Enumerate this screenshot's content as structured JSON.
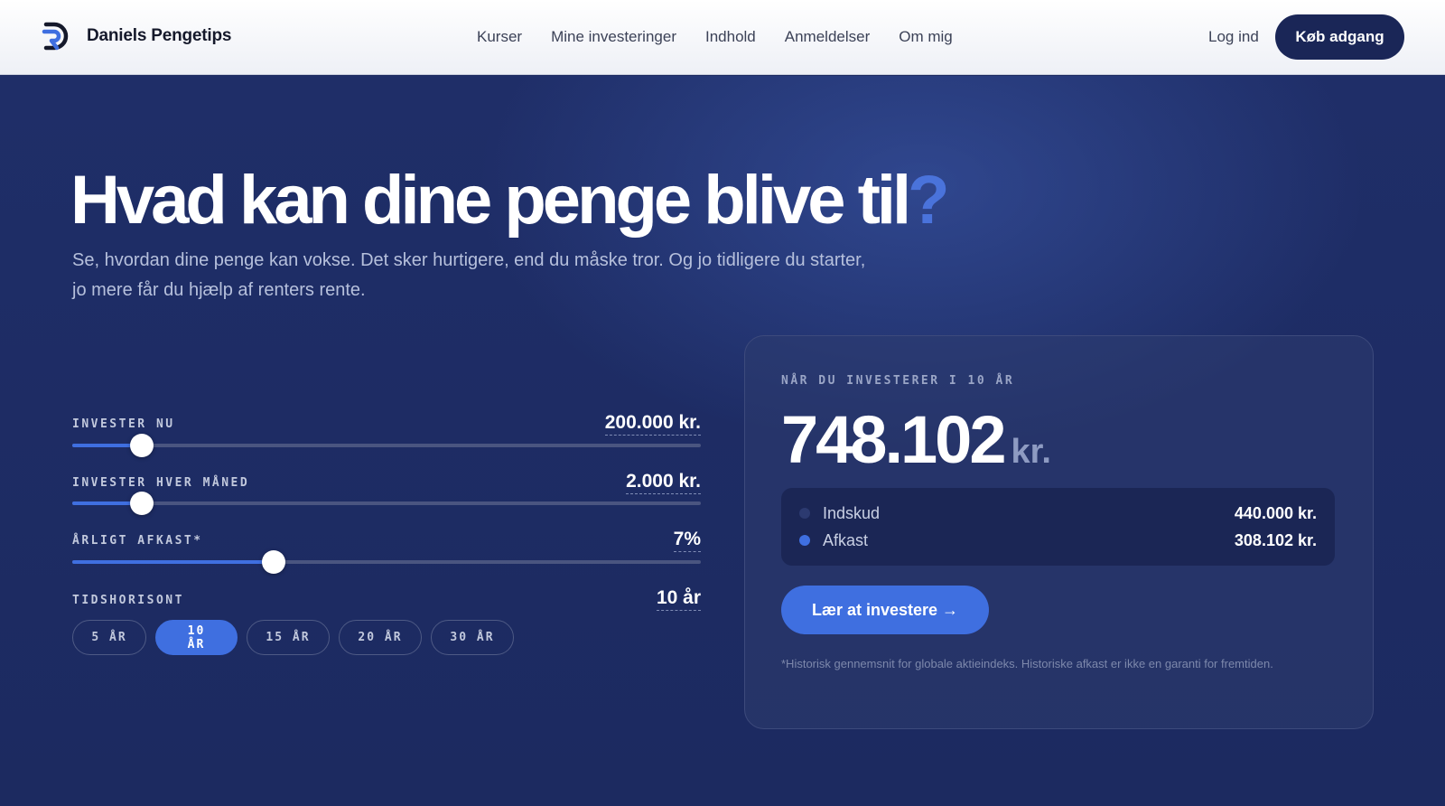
{
  "header": {
    "brand": "Daniels Pengetips",
    "nav": [
      "Kurser",
      "Mine investeringer",
      "Indhold",
      "Anmeldelser",
      "Om mig"
    ],
    "login": "Log ind",
    "cta": "Køb adgang"
  },
  "hero": {
    "title": "Hvad kan dine penge blive til",
    "title_mark": "?",
    "subtitle": "Se, hvordan dine penge kan vokse. Det sker hurtigere, end du måske tror. Og jo tidligere du starter, jo mere får du hjælp af renters rente."
  },
  "calculator": {
    "invest_now": {
      "label": "INVESTER NU",
      "value": "200.000 kr.",
      "level": 0.11
    },
    "invest_monthly": {
      "label": "INVESTER HVER MÅNED",
      "value": "2.000 kr.",
      "level": 0.11
    },
    "annual_return": {
      "label": "ÅRLIGT AFKAST*",
      "value": "7%",
      "level": 0.32
    },
    "horizon": {
      "label": "TIDSHORISONT",
      "value": "10 år",
      "options": [
        "5 ÅR",
        "10 ÅR",
        "15 ÅR",
        "20 ÅR",
        "30 ÅR"
      ],
      "selected": "10 ÅR"
    }
  },
  "result": {
    "label": "NÅR DU INVESTERER I 10 ÅR",
    "total": "748.102",
    "unit": "kr.",
    "rows": [
      {
        "name": "Indskud",
        "value": "440.000 kr.",
        "color": "#2c3a70"
      },
      {
        "name": "Afkast",
        "value": "308.102 kr.",
        "color": "#3f6fe0"
      }
    ],
    "cta": "Lær at investere →",
    "disclaimer": "*Historisk gennemsnit for globale aktieindeks. Historiske afkast er ikke en garanti for fremtiden."
  },
  "colors": {
    "navy": "#1a2657",
    "accent": "#3f6fe0",
    "background": "#1d2b62"
  }
}
